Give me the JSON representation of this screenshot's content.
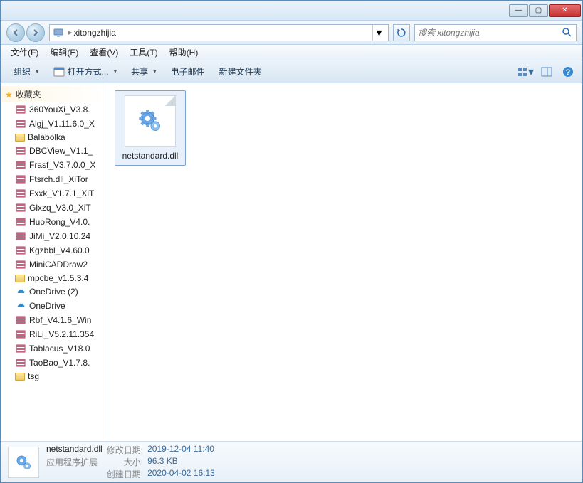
{
  "titlebar": {},
  "nav": {
    "path_folder": "xitongzhijia",
    "search_placeholder": "搜索 xitongzhijia"
  },
  "menu": {
    "file": "文件(F)",
    "edit": "编辑(E)",
    "view": "查看(V)",
    "tools": "工具(T)",
    "help": "帮助(H)"
  },
  "toolbar": {
    "organize": "组织",
    "open_with": "打开方式...",
    "share": "共享",
    "email": "电子邮件",
    "new_folder": "新建文件夹"
  },
  "sidebar": {
    "favorites_label": "收藏夹",
    "items": [
      {
        "label": "360YouXi_V3.8.",
        "icon": "archive"
      },
      {
        "label": "Algj_V1.11.6.0_X",
        "icon": "archive"
      },
      {
        "label": "Balabolka",
        "icon": "folder"
      },
      {
        "label": "DBCView_V1.1_",
        "icon": "archive"
      },
      {
        "label": "Frasf_V3.7.0.0_X",
        "icon": "archive"
      },
      {
        "label": "Ftsrch.dll_XiTor",
        "icon": "archive"
      },
      {
        "label": "Fxxk_V1.7.1_XiT",
        "icon": "archive"
      },
      {
        "label": "Glxzq_V3.0_XiT",
        "icon": "archive"
      },
      {
        "label": "HuoRong_V4.0.",
        "icon": "archive"
      },
      {
        "label": "JiMi_V2.0.10.24",
        "icon": "archive"
      },
      {
        "label": "Kgzbbl_V4.60.0",
        "icon": "archive"
      },
      {
        "label": "MiniCADDraw2",
        "icon": "archive"
      },
      {
        "label": "mpcbe_v1.5.3.4",
        "icon": "folder"
      },
      {
        "label": "OneDrive (2)",
        "icon": "onedrive"
      },
      {
        "label": "OneDrive",
        "icon": "onedrive"
      },
      {
        "label": "Rbf_V4.1.6_Win",
        "icon": "archive"
      },
      {
        "label": "RiLi_V5.2.11.354",
        "icon": "archive"
      },
      {
        "label": "Tablacus_V18.0",
        "icon": "archive"
      },
      {
        "label": "TaoBao_V1.7.8.",
        "icon": "archive"
      },
      {
        "label": "tsg",
        "icon": "folder"
      }
    ]
  },
  "content": {
    "file_name": "netstandard.dll"
  },
  "details": {
    "filename": "netstandard.dll",
    "type": "应用程序扩展",
    "mod_label": "修改日期:",
    "mod_val": "2019-12-04 11:40",
    "size_label": "大小:",
    "size_val": "96.3 KB",
    "create_label": "创建日期:",
    "create_val": "2020-04-02 16:13"
  }
}
